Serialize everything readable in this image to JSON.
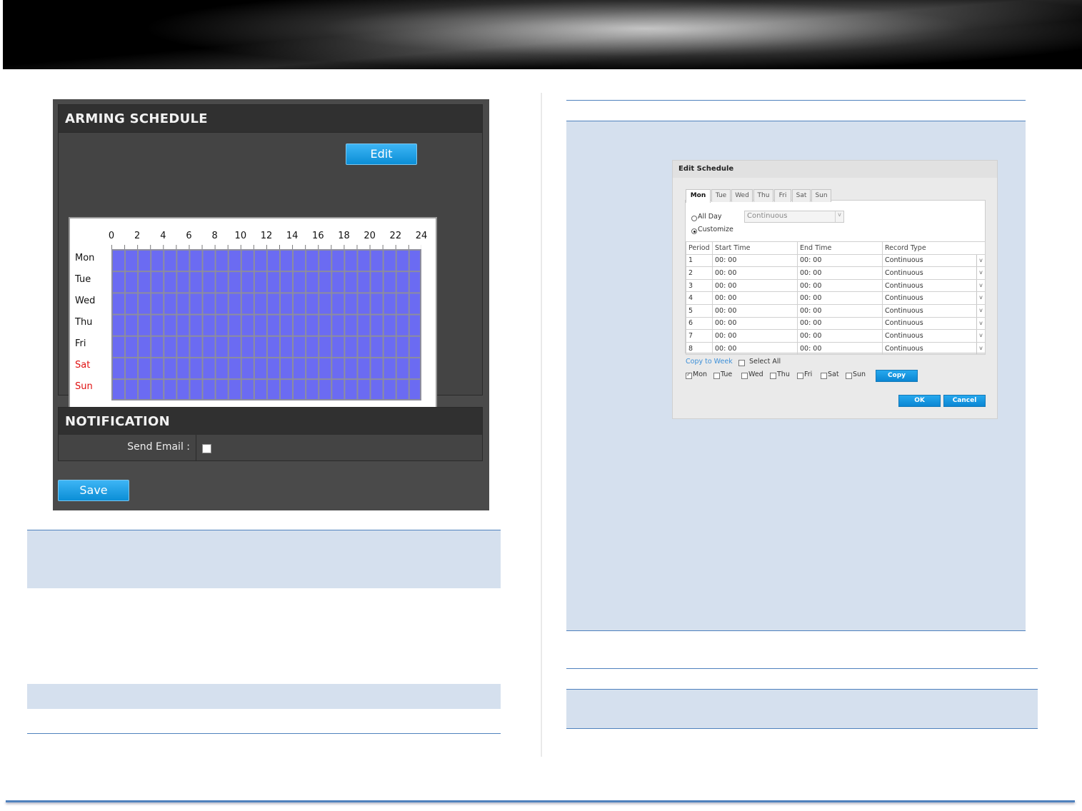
{
  "arming": {
    "title": "ARMING SCHEDULE",
    "edit_label": "Edit",
    "hours": [
      "0",
      "2",
      "4",
      "6",
      "8",
      "10",
      "12",
      "14",
      "16",
      "18",
      "20",
      "22",
      "24"
    ],
    "days": [
      {
        "label": "Mon",
        "weekend": false
      },
      {
        "label": "Tue",
        "weekend": false
      },
      {
        "label": "Wed",
        "weekend": false
      },
      {
        "label": "Thu",
        "weekend": false
      },
      {
        "label": "Fri",
        "weekend": false
      },
      {
        "label": "Sat",
        "weekend": true
      },
      {
        "label": "Sun",
        "weekend": true
      }
    ],
    "grid_color": "#6b6bf2",
    "weekend_color": "#e01010"
  },
  "notification": {
    "title": "NOTIFICATION",
    "send_email_label": "Send Email :",
    "send_email_checked": false
  },
  "save_label": "Save",
  "accent_color": "#4f81bd",
  "dialog": {
    "title": "Edit Schedule",
    "tabs": [
      "Mon",
      "Tue",
      "Wed",
      "Thu",
      "Fri",
      "Sat",
      "Sun"
    ],
    "active_tab": "Mon",
    "all_day_label": "All Day",
    "customize_label": "Customize",
    "selected_mode": "Customize",
    "all_day_select": "Continuous",
    "columns": [
      "Period",
      "Start Time",
      "End Time",
      "Record Type"
    ],
    "rows": [
      {
        "period": "1",
        "start": "00: 00",
        "end": "00: 00",
        "type": "Continuous"
      },
      {
        "period": "2",
        "start": "00: 00",
        "end": "00: 00",
        "type": "Continuous"
      },
      {
        "period": "3",
        "start": "00: 00",
        "end": "00: 00",
        "type": "Continuous"
      },
      {
        "period": "4",
        "start": "00: 00",
        "end": "00: 00",
        "type": "Continuous"
      },
      {
        "period": "5",
        "start": "00: 00",
        "end": "00: 00",
        "type": "Continuous"
      },
      {
        "period": "6",
        "start": "00: 00",
        "end": "00: 00",
        "type": "Continuous"
      },
      {
        "period": "7",
        "start": "00: 00",
        "end": "00: 00",
        "type": "Continuous"
      },
      {
        "period": "8",
        "start": "00: 00",
        "end": "00: 00",
        "type": "Continuous"
      }
    ],
    "copy_to_week_label": "Copy to Week",
    "select_all_label": "Select All",
    "copy_days": [
      {
        "label": "Mon",
        "checked": true
      },
      {
        "label": "Tue",
        "checked": false
      },
      {
        "label": "Wed",
        "checked": false
      },
      {
        "label": "Thu",
        "checked": false
      },
      {
        "label": "Fri",
        "checked": false
      },
      {
        "label": "Sat",
        "checked": false
      },
      {
        "label": "Sun",
        "checked": false
      }
    ],
    "copy_label": "Copy",
    "ok_label": "OK",
    "cancel_label": "Cancel"
  }
}
